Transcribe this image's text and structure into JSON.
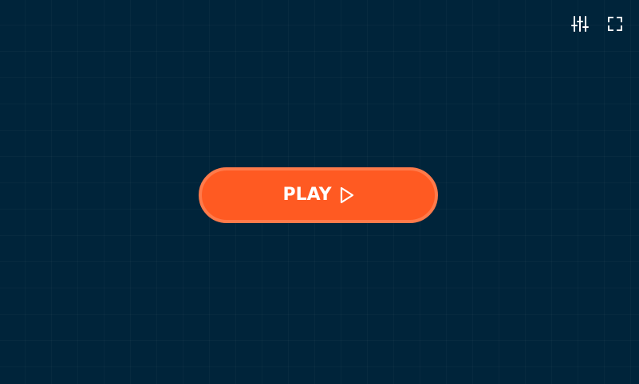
{
  "game": {
    "play_label": "PLAY",
    "play_icon": "play-triangle-icon",
    "settings_icon": "sliders-icon",
    "fullscreen_icon": "fullscreen-icon"
  },
  "colors": {
    "background": "#00243a",
    "play_button": "#ff5a22",
    "play_button_border": "#ff7a4a",
    "icon": "#ffffff"
  }
}
